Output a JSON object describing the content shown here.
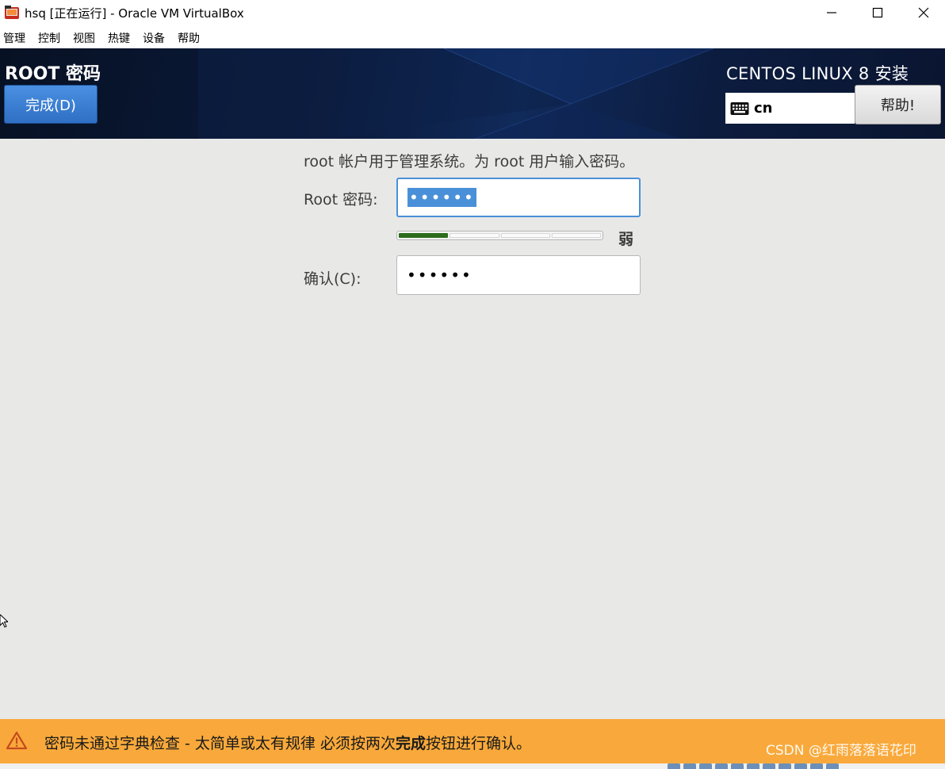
{
  "window": {
    "title": "hsq [正在运行] - Oracle VM VirtualBox",
    "menu": [
      "管理",
      "控制",
      "视图",
      "热键",
      "设备",
      "帮助"
    ]
  },
  "header": {
    "spoke_title": "ROOT 密码",
    "done_label": "完成(D)",
    "product_title": "CENTOS LINUX 8 安装",
    "keyboard_layout": "cn",
    "help_label": "帮助!"
  },
  "form": {
    "intro": "root 帐户用于管理系统。为 root 用户输入密码。",
    "root_password_label": "Root 密码:",
    "root_password_value": "••••••",
    "confirm_label": "确认(C):",
    "confirm_value": "••••••",
    "strength": {
      "label": "弱",
      "filled_segments": 1,
      "total_segments": 4
    }
  },
  "warning": {
    "text_before": "密码未通过字典检查 - 太简单或太有规律 必须按两次",
    "text_bold": "完成",
    "text_after": "按钮进行确认。"
  },
  "watermark": "CSDN @红雨落落语花印",
  "colors": {
    "header_bg": "#0b1a3a",
    "done_button": "#3a7fd5",
    "content_bg": "#e8e8e7",
    "strength_fill": "#2d6c1c",
    "warning_bg": "#f9a93b",
    "focus_border": "#4a90d9"
  },
  "icons": {
    "app": "virtualbox-icon",
    "keyboard": "keyboard-icon",
    "warning": "warning-triangle-icon",
    "cursor": "mouse-pointer-icon"
  }
}
